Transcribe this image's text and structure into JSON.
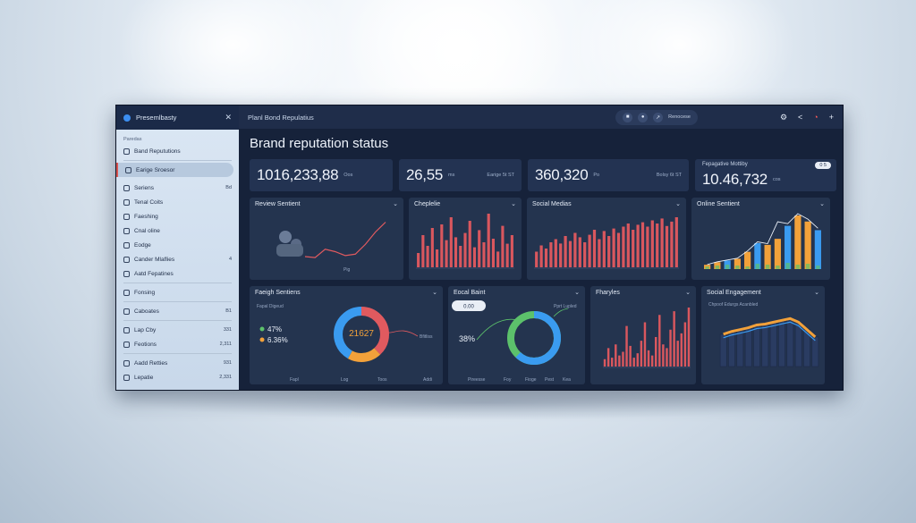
{
  "sidebar": {
    "title": "Presemlbasty",
    "section": "Paredas",
    "items": [
      {
        "label": "Band Repututions",
        "value": ""
      },
      {
        "label": "Earige Sroesor",
        "value": ""
      },
      {
        "label": "Seriens",
        "value": "Bd"
      },
      {
        "label": "Tenal Coits",
        "value": ""
      },
      {
        "label": "Faeshing",
        "value": ""
      },
      {
        "label": "Cnal oline",
        "value": ""
      },
      {
        "label": "Eodge",
        "value": ""
      },
      {
        "label": "Cander Mlaflies",
        "value": "4"
      },
      {
        "label": "Aatd Fepatines",
        "value": ""
      },
      {
        "label": "Fonsing",
        "value": ""
      },
      {
        "label": "Caboates",
        "value": "B1"
      },
      {
        "label": "Lap Cby",
        "value": "331"
      },
      {
        "label": "Feotions",
        "value": "2,311"
      },
      {
        "label": "Aadd Retties",
        "value": "931"
      },
      {
        "label": "Lepatie",
        "value": "2,331"
      }
    ]
  },
  "topbar": {
    "title": "Planl Bond Repulatius",
    "pill_label": "Renocese"
  },
  "page_title": "Brand reputation status",
  "kpis": [
    {
      "value": "1016,233,88",
      "suffix": "Oos",
      "right": ""
    },
    {
      "value": "26,55",
      "suffix": "ms",
      "right": "Earige 5t ST"
    },
    {
      "value": "360,320",
      "suffix": "Po",
      "right": "Bolsy 6t ST"
    },
    {
      "header": "Fepagative Mottiby",
      "badge": "0 5",
      "value": "10.46,732",
      "suffix": "cos"
    }
  ],
  "cards_row1": [
    {
      "title": "Review Sentient"
    },
    {
      "title": "Cheplelie"
    },
    {
      "title": "Social Medias"
    },
    {
      "title": "Online Sentient"
    }
  ],
  "cards_row2": [
    {
      "title": "Faeigh Sentiens",
      "header_note": "Fapal Digeud",
      "legend": [
        "47%",
        "6.36%"
      ],
      "center": "21627",
      "callout": "Bfitliss",
      "footer": [
        "Fapl",
        "Log",
        "Toos",
        "Addi"
      ]
    },
    {
      "title": "Eocal Baint",
      "pill": "0.00",
      "legend": [
        "38%"
      ],
      "callout": "Pprt Lupled",
      "footer": [
        "Pireesse",
        "Foy",
        "Fioge",
        "Pest",
        "Kea"
      ]
    },
    {
      "title": "Fharyles"
    },
    {
      "title": "Social Engagement",
      "note": "Chpoof Edurgs Acanbled"
    }
  ],
  "icons": [
    "logo-icon",
    "close-icon",
    "lock-icon",
    "refresh-icon",
    "tool-icon",
    "gear-icon",
    "share-icon",
    "notification-icon",
    "plus-icon",
    "chevron-down-icon"
  ],
  "colors": {
    "accent_red": "#e05a5f",
    "accent_orange": "#f2a13a",
    "accent_blue": "#3a9bf0",
    "accent_green": "#5cc16b",
    "panel": "#24344f"
  },
  "chart_data": [
    {
      "type": "line",
      "title": "Review Sentient",
      "x_tick": "Pig",
      "values": [
        0.2,
        0.18,
        0.35,
        0.3,
        0.22,
        0.25,
        0.45,
        0.7,
        0.9
      ]
    },
    {
      "type": "bar",
      "title": "Cheplelie",
      "values": [
        20,
        45,
        30,
        55,
        25,
        60,
        38,
        70,
        42,
        30,
        48,
        65,
        28,
        52,
        35,
        75,
        40,
        22,
        58,
        33,
        45
      ]
    },
    {
      "type": "bar",
      "title": "Social Medias",
      "values": [
        25,
        35,
        30,
        40,
        45,
        38,
        50,
        42,
        55,
        48,
        40,
        52,
        60,
        45,
        58,
        50,
        62,
        55,
        65,
        70,
        60,
        68,
        72,
        65,
        75,
        70,
        78,
        66,
        73,
        80
      ]
    },
    {
      "type": "bar",
      "title": "Online Sentient",
      "series": [
        {
          "name": "",
          "values": [
            5,
            8,
            10,
            12,
            20,
            30,
            28,
            35,
            50,
            62,
            55,
            45
          ]
        },
        {
          "name": "",
          "values": [
            3,
            4,
            5,
            4,
            3,
            6,
            5,
            4,
            7,
            5,
            6,
            4
          ]
        }
      ]
    },
    {
      "type": "pie",
      "title": "Faeigh Sentiens",
      "values": [
        47,
        6.36,
        46.64
      ],
      "center_label": "21627"
    },
    {
      "type": "pie",
      "title": "Eocal Baint",
      "values": [
        38,
        62
      ]
    },
    {
      "type": "bar",
      "title": "Fharyles",
      "values": [
        10,
        25,
        12,
        30,
        15,
        20,
        55,
        28,
        12,
        18,
        35,
        60,
        22,
        15,
        40,
        70,
        30,
        25,
        50,
        75,
        35,
        45,
        60,
        80
      ]
    },
    {
      "type": "area",
      "title": "Social Engagement",
      "values": [
        55,
        58,
        60,
        62,
        65,
        66,
        68,
        70,
        72,
        68,
        60,
        52
      ]
    }
  ]
}
